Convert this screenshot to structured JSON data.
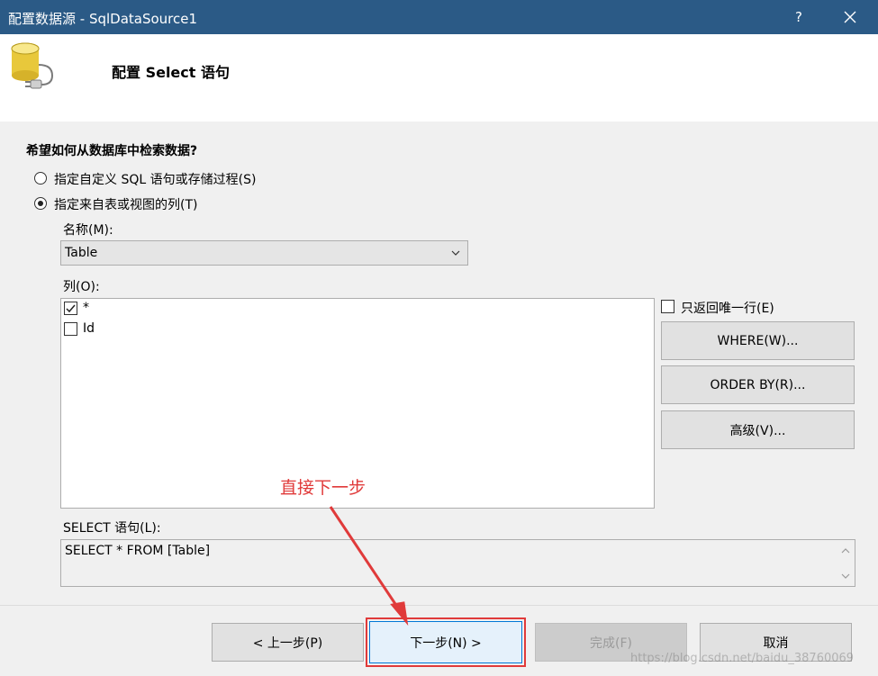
{
  "window": {
    "title": "配置数据源 - SqlDataSource1",
    "help_label": "?"
  },
  "header": {
    "title": "配置 Select 语句"
  },
  "question": "希望如何从数据库中检索数据?",
  "options": {
    "custom_sql": {
      "label": "指定自定义 SQL 语句或存储过程(S)",
      "selected": false
    },
    "from_table": {
      "label": "指定来自表或视图的列(T)",
      "selected": true
    }
  },
  "name": {
    "label": "名称(M):",
    "value": "Table"
  },
  "columns": {
    "label": "列(O):",
    "items": [
      {
        "label": "*",
        "checked": true
      },
      {
        "label": "Id",
        "checked": false
      }
    ]
  },
  "unique_rows": {
    "label": "只返回唯一行(E)",
    "checked": false
  },
  "buttons": {
    "where": "WHERE(W)...",
    "order_by": "ORDER BY(R)...",
    "advanced": "高级(V)...",
    "prev": "< 上一步(P)",
    "next": "下一步(N) >",
    "finish": "完成(F)",
    "cancel": "取消"
  },
  "annotation": "直接下一步",
  "sql": {
    "label": "SELECT 语句(L):",
    "value": "SELECT * FROM [Table]"
  },
  "watermark": "https://blog.csdn.net/baidu_38760069",
  "colors": {
    "titlebar": "#2b5a86",
    "annotation": "#e03a3a",
    "primary_border": "#0078d7"
  }
}
